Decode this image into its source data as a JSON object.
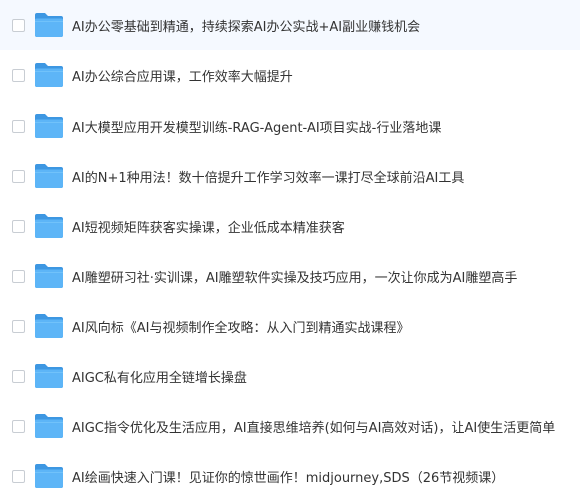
{
  "folders": [
    {
      "name": "AI办公零基础到精通，持续探索AI办公实战+AI副业赚钱机会"
    },
    {
      "name": "AI办公综合应用课，工作效率大幅提升"
    },
    {
      "name": "AI大模型应用开发模型训练-RAG-Agent-AI项目实战-行业落地课"
    },
    {
      "name": "AI的N+1种用法！数十倍提升工作学习效率一课打尽全球前沿AI工具"
    },
    {
      "name": "AI短视频矩阵获客实操课，企业低成本精准获客"
    },
    {
      "name": "AI雕塑研习社·实训课，AI雕塑软件实操及技巧应用，一次让你成为AI雕塑高手"
    },
    {
      "name": "AI风向标《AI与视频制作全攻略：从入门到精通实战课程》"
    },
    {
      "name": "AIGC私有化应用全链增长操盘"
    },
    {
      "name": "AIGC指令优化及生活应用，AI直接思维培养(如何与AI高效对话)，让AI使生活更简单"
    },
    {
      "name": "AI绘画快速入门课！见证你的惊世画作！midjourney,SDS（26节视频课）"
    }
  ],
  "icons": {
    "row_icon": "folder-icon",
    "selector": "checkbox"
  },
  "colors": {
    "folder_body": "#4aa8f0",
    "folder_tab": "#3d97e2",
    "folder_front": "#6cc0fb",
    "text": "#333333",
    "checkbox_border": "#c8cdd3"
  }
}
